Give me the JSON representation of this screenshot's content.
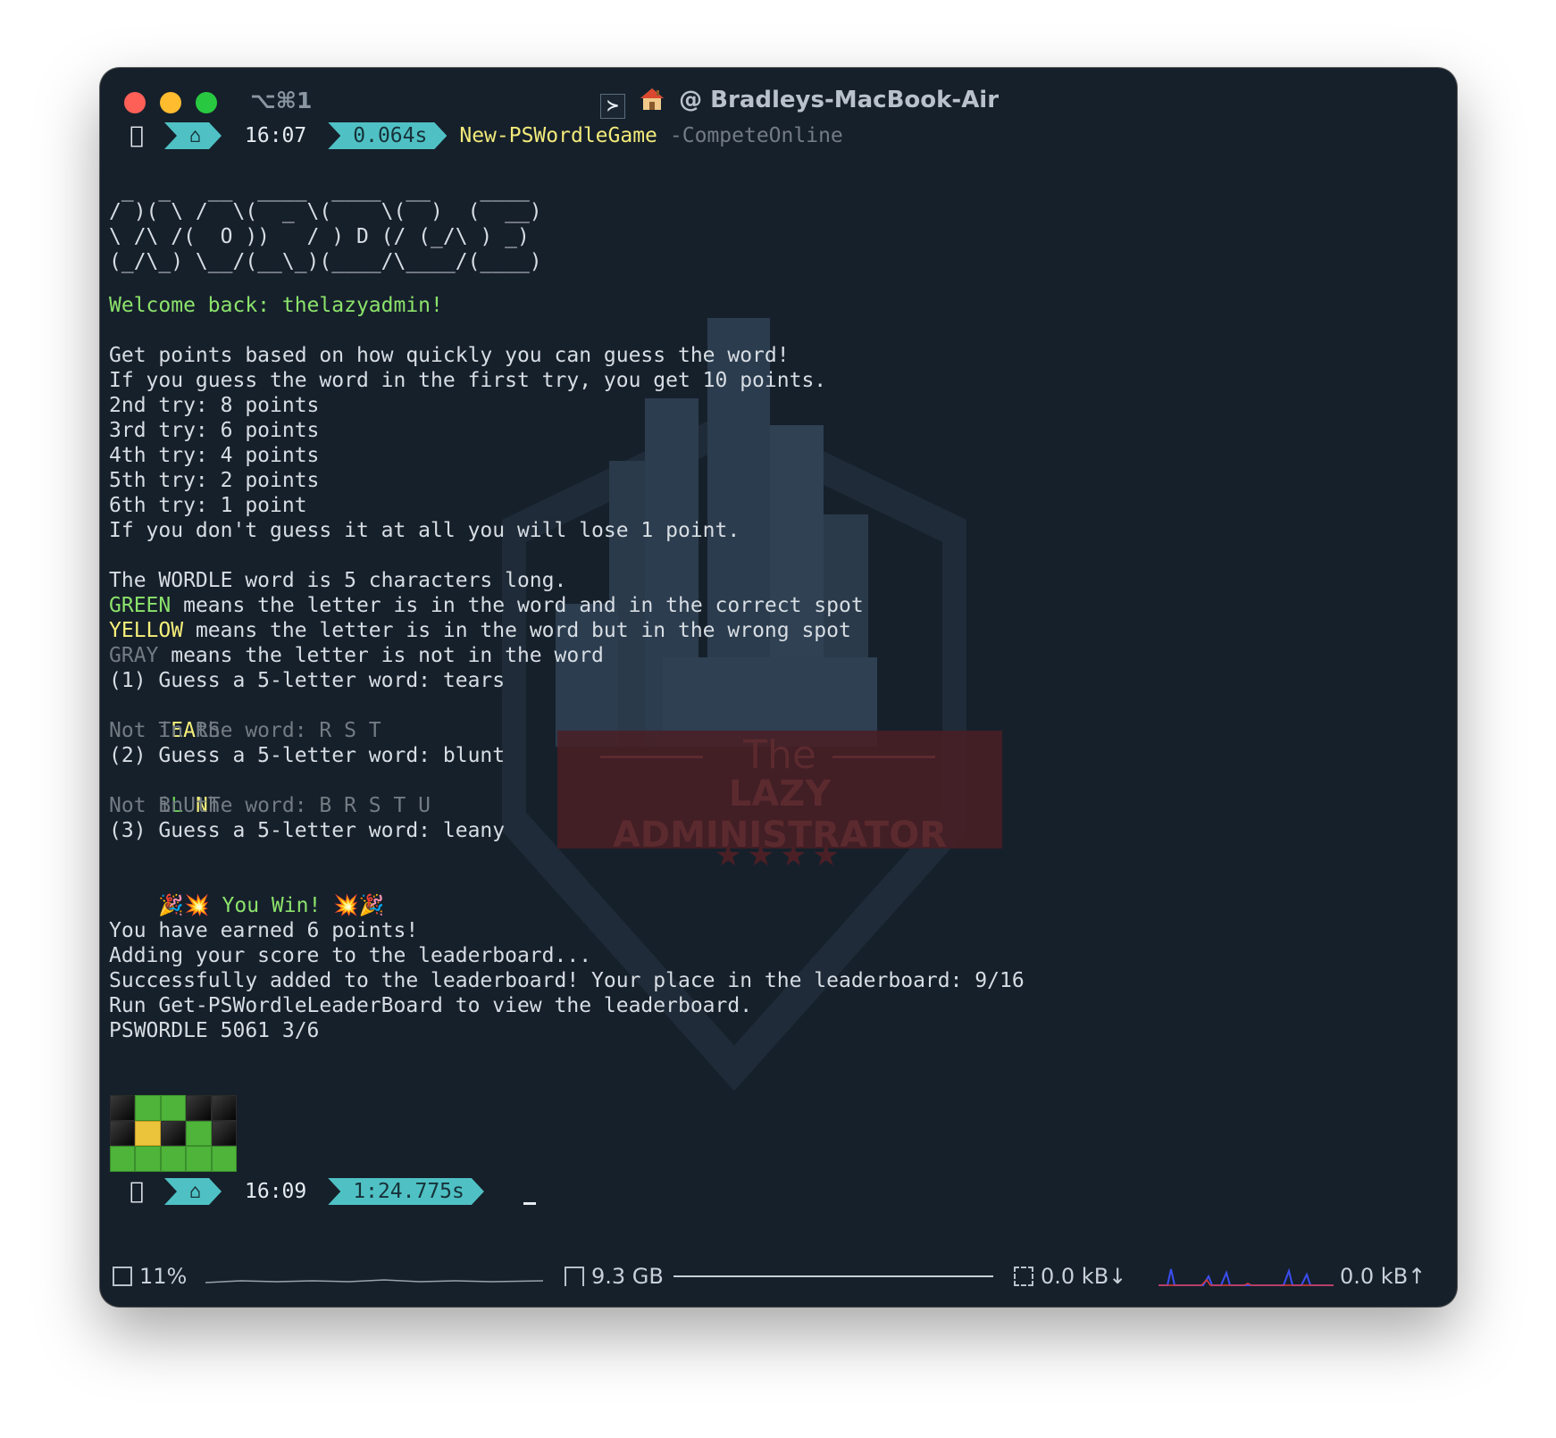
{
  "window": {
    "shortcut": "⌥⌘1",
    "title_host": "@ Bradleys-MacBook-Air"
  },
  "prompt1": {
    "time": "16:07",
    "duration": "0.064s",
    "command": "New-PSWordleGame",
    "arg": "-CompeteOnline"
  },
  "ascii_art": [
    " _  _   __  ____  ____  __    ____ ",
    "/ )( \\ /  \\(  _ \\(    \\(  )  (  __)",
    "\\ /\\ /(  O ))   / ) D (/ (_/\\ ) _) ",
    "(_/\\_) \\__/(__\\_)(____/\\____/(____)"
  ],
  "welcome": "Welcome back: thelazyadmin!",
  "rules": [
    "Get points based on how quickly you can guess the word!",
    "If you guess the word in the first try, you get 10 points.",
    "2nd try: 8 points",
    "3rd try: 6 points",
    "4th try: 4 points",
    "5th try: 2 points",
    "6th try: 1 point",
    "If you don't guess it at all you will lose 1 point."
  ],
  "legend": {
    "length": "The WORDLE word is 5 characters long.",
    "green_word": "GREEN",
    "green_text": " means the letter is in the word and in the correct spot",
    "yellow_word": "YELLOW",
    "yellow_text": " means the letter is in the word but in the wrong spot",
    "gray_word": "GRAY",
    "gray_text": " means the letter is not in the word"
  },
  "guesses": [
    {
      "prompt": "(1) Guess a 5-letter word: tears",
      "letters": [
        {
          "ch": "T",
          "state": "gray"
        },
        {
          "ch": "E",
          "state": "yellow"
        },
        {
          "ch": "A",
          "state": "yellow"
        },
        {
          "ch": "R",
          "state": "gray"
        },
        {
          "ch": "S",
          "state": "gray"
        }
      ],
      "not_in_word": "Not in the word: R S T"
    },
    {
      "prompt": "(2) Guess a 5-letter word: blunt",
      "letters": [
        {
          "ch": "B",
          "state": "gray"
        },
        {
          "ch": "L",
          "state": "green"
        },
        {
          "ch": "U",
          "state": "gray"
        },
        {
          "ch": "N",
          "state": "yellow"
        },
        {
          "ch": "T",
          "state": "gray"
        }
      ],
      "not_in_word": "Not in the word: B R S T U"
    },
    {
      "prompt": "(3) Guess a 5-letter word: leany"
    }
  ],
  "win": {
    "emoji_left": "🎉💥",
    "text": " You Win! ",
    "emoji_right": "💥🎉"
  },
  "results": [
    "You have earned 6 points!",
    "Adding your score to the leaderboard...",
    "Successfully added to the leaderboard! Your place in the leaderboard: 9/16",
    "Run Get-PSWordleLeaderBoard to view the leaderboard.",
    "PSWORDLE 5061 3/6"
  ],
  "share_grid": [
    [
      "black",
      "green",
      "green",
      "black",
      "black"
    ],
    [
      "black",
      "yellow",
      "black",
      "green",
      "black"
    ],
    [
      "green",
      "green",
      "green",
      "green",
      "green"
    ]
  ],
  "prompt2": {
    "time": "16:09",
    "duration": "1:24.775s"
  },
  "watermark": {
    "line1": "The",
    "line2": "LAZY ADMINISTRATOR",
    "stars": "★★★★"
  },
  "statusbar": {
    "cpu": "11%",
    "memory": "9.3 GB",
    "net_down": "0.0 kB↓",
    "net_up": "0.0 kB↑"
  },
  "colors": {
    "background": "#16202b",
    "accent_cyan": "#4fc1c4",
    "green": "#8ce36b",
    "yellow": "#f6f07a",
    "gray": "#737b83"
  }
}
